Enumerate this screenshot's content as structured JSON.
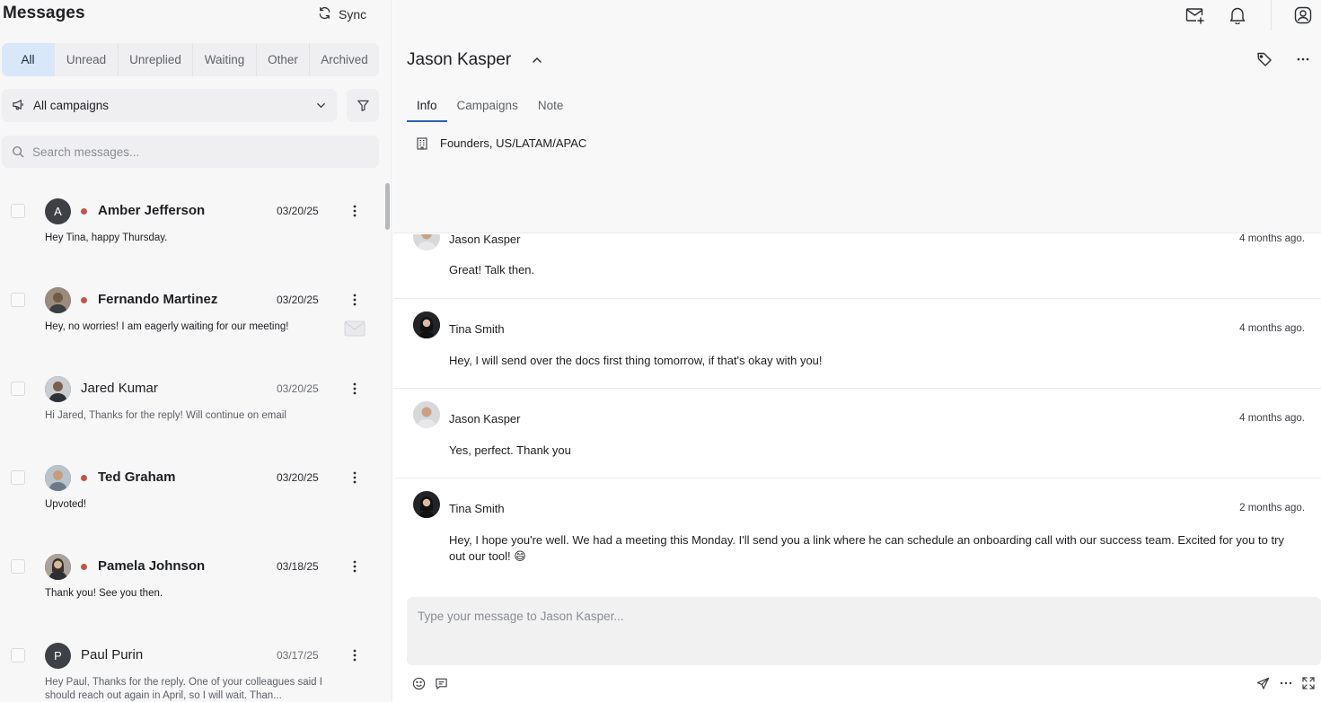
{
  "sidebar": {
    "title": "Messages",
    "sync_label": "Sync",
    "tabs": [
      {
        "label": "All",
        "active": true
      },
      {
        "label": "Unread"
      },
      {
        "label": "Unreplied"
      },
      {
        "label": "Waiting"
      },
      {
        "label": "Other"
      },
      {
        "label": "Archived"
      }
    ],
    "campaign_filter": "All campaigns",
    "search_placeholder": "Search messages..."
  },
  "conversations": [
    {
      "initial": "A",
      "name": "Amber Jefferson",
      "date": "03/20/25",
      "snippet": "Hey Tina, happy Thursday.",
      "unread": true
    },
    {
      "initial": "",
      "name": "Fernando Martinez",
      "date": "03/20/25",
      "snippet": "Hey, no worries! I am eagerly waiting for our meeting!",
      "unread": true
    },
    {
      "initial": "",
      "name": "Jared Kumar",
      "date": "03/20/25",
      "snippet": "Hi Jared, Thanks for the reply! Will continue on email",
      "unread": false
    },
    {
      "initial": "",
      "name": "Ted Graham",
      "date": "03/20/25",
      "snippet": "Upvoted!",
      "unread": true
    },
    {
      "initial": "",
      "name": "Pamela Johnson",
      "date": "03/18/25",
      "snippet": "Thank you!  See you then.",
      "unread": true
    },
    {
      "initial": "P",
      "name": "Paul Purin",
      "date": "03/17/25",
      "snippet": "Hey Paul, Thanks for the reply. One of your colleagues said I should reach out again in April, so I will wait. Than...",
      "unread": false
    }
  ],
  "contact": {
    "name": "Jason Kasper",
    "tabs": [
      "Info",
      "Campaigns",
      "Note"
    ],
    "active_tab": "Info",
    "company": "Founders, US/LATAM/APAC"
  },
  "thread": [
    {
      "sender": "Jason Kasper",
      "time": "4 months ago.",
      "text": "Great! Talk then."
    },
    {
      "sender": "Tina Smith",
      "time": "4 months ago.",
      "text": "Hey, I will send over the docs first thing tomorrow, if that's okay with you!"
    },
    {
      "sender": "Jason Kasper",
      "time": "4 months ago.",
      "text": "Yes, perfect. Thank you"
    },
    {
      "sender": "Tina Smith",
      "time": "2 months ago.",
      "text": "Hey, I hope you're well. We had a meeting this Monday. I'll send you a link where he can schedule an onboarding call with our success team. Excited for you to try out our tool! 😄"
    }
  ],
  "composer": {
    "placeholder": "Type your message to Jason Kasper..."
  },
  "colors": {
    "accent": "#2b5fb8",
    "active_tab_bg": "#d9e7fb",
    "unread_dot": "#c0574a",
    "panel_bg": "#f7f7f8"
  }
}
